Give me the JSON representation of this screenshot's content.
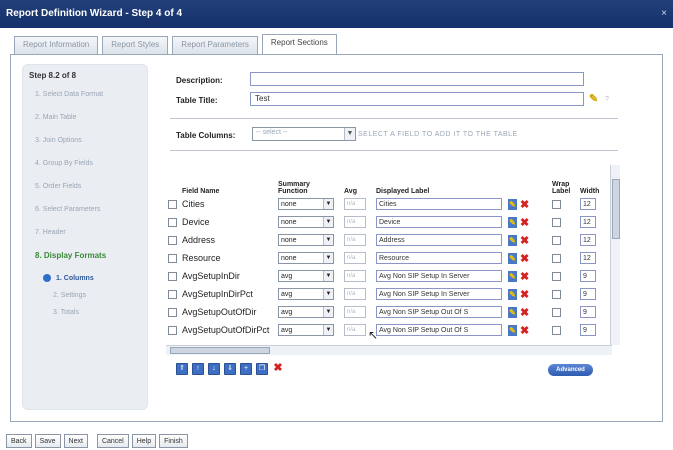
{
  "window": {
    "title": "Report Definition Wizard - Step 4 of 4",
    "close": "×"
  },
  "tabs": [
    "Report Information",
    "Report Styles",
    "Report Parameters",
    "Report Sections"
  ],
  "left_panel": {
    "step": "Step 8.2 of 8",
    "items": [
      "1. Select Data Format",
      "2. Main Table",
      "3. Join Options",
      "4. Group By Fields",
      "5. Order Fields",
      "6. Select Parameters",
      "7. Header",
      "8. Display Formats"
    ],
    "current_item": "8. Display Formats",
    "subitems": [
      "1. Columns",
      "2. Settings",
      "3. Totals"
    ]
  },
  "form": {
    "description_label": "Description:",
    "description_value": "",
    "table_title_label": "Table Title:",
    "table_title_value": "Test",
    "table_columns_label": "Table Columns:",
    "table_columns_select": "-- select --",
    "table_columns_hint": "SELECT A FIELD TO ADD IT TO THE TABLE"
  },
  "grid": {
    "headers": {
      "field_name": "Field Name",
      "summary": "Summary Function",
      "avg": "Avg",
      "displayed_label": "Displayed Label",
      "wrap": "Wrap Label",
      "width": "Width"
    },
    "rows": [
      {
        "field": "Cities",
        "func": "none",
        "avg": "n/a",
        "label": "Cities",
        "width": "12"
      },
      {
        "field": "Device",
        "func": "none",
        "avg": "n/a",
        "label": "Device",
        "width": "12"
      },
      {
        "field": "Address",
        "func": "none",
        "avg": "n/a",
        "label": "Address",
        "width": "12"
      },
      {
        "field": "Resource",
        "func": "none",
        "avg": "n/a",
        "label": "Resource",
        "width": "12"
      },
      {
        "field": "AvgSetupInDir",
        "func": "avg",
        "avg": "n/a",
        "label": "Avg Non SIP Setup In Server",
        "width": "9"
      },
      {
        "field": "AvgSetupInDirPct",
        "func": "avg",
        "avg": "n/a",
        "label": "Avg Non SIP Setup In Server",
        "width": "9"
      },
      {
        "field": "AvgSetupOutOfDir",
        "func": "avg",
        "avg": "n/a",
        "label": "Avg Non SIP Setup Out Of S",
        "width": "9"
      },
      {
        "field": "AvgSetupOutOfDirPct",
        "func": "avg",
        "avg": "n/a",
        "label": "Avg Non SIP Setup Out Of S",
        "width": "9"
      }
    ]
  },
  "toolbar": {
    "advanced_label": "Advanced"
  },
  "bottom_buttons": [
    "Back",
    "Save",
    "Next",
    "Cancel",
    "Help",
    "Finish"
  ],
  "colors": {
    "titlebar": "#1b3772",
    "current_step": "#3a8a3a",
    "delete": "#d42222"
  }
}
